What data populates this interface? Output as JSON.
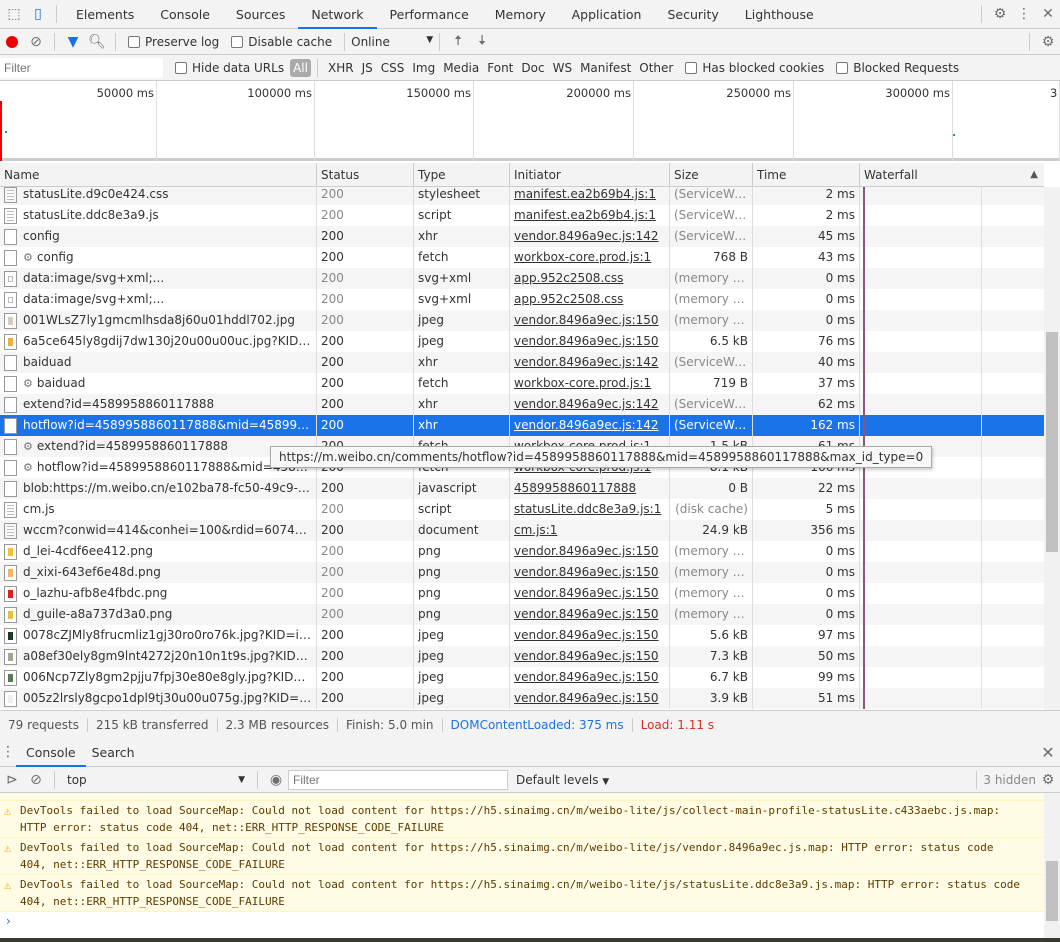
{
  "tabs": [
    "Elements",
    "Console",
    "Sources",
    "Network",
    "Performance",
    "Memory",
    "Application",
    "Security",
    "Lighthouse"
  ],
  "active_tab": "Network",
  "toolbar": {
    "preserve_log": "Preserve log",
    "disable_cache": "Disable cache",
    "throttle": "Online"
  },
  "filterbar": {
    "placeholder": "Filter",
    "hide_data_urls": "Hide data URLs",
    "types": [
      "All",
      "XHR",
      "JS",
      "CSS",
      "Img",
      "Media",
      "Font",
      "Doc",
      "WS",
      "Manifest",
      "Other"
    ],
    "has_blocked_cookies": "Has blocked cookies",
    "blocked_requests": "Blocked Requests"
  },
  "overview": {
    "ticks": [
      "50000 ms",
      "100000 ms",
      "150000 ms",
      "200000 ms",
      "250000 ms",
      "300000 ms",
      "3"
    ]
  },
  "columns": [
    "Name",
    "Status",
    "Type",
    "Initiator",
    "Size",
    "Time",
    "Waterfall"
  ],
  "rows": [
    {
      "icon": "doc",
      "name": "statusLite.d9c0e424.css",
      "status": "200",
      "type": "stylesheet",
      "initiator": "manifest.ea2b69b4.js:1",
      "size": "(ServiceWor...",
      "time": "2 ms",
      "cached": true
    },
    {
      "icon": "doc",
      "name": "statusLite.ddc8e3a9.js",
      "status": "200",
      "type": "script",
      "initiator": "manifest.ea2b69b4.js:1",
      "size": "(ServiceWor...",
      "time": "2 ms",
      "cached": true
    },
    {
      "icon": "blank",
      "name": "config",
      "status": "200",
      "type": "xhr",
      "initiator": "vendor.8496a9ec.js:142",
      "size": "(ServiceWor...",
      "time": "45 ms"
    },
    {
      "icon": "blank",
      "sw": true,
      "name": "config",
      "status": "200",
      "type": "fetch",
      "initiator": "workbox-core.prod.js:1",
      "size": "768 B",
      "time": "43 ms"
    },
    {
      "icon": "svg",
      "name": "data:image/svg+xml;...",
      "status": "200",
      "type": "svg+xml",
      "initiator": "app.952c2508.css",
      "size": "(memory ca...",
      "time": "0 ms",
      "cached": true
    },
    {
      "icon": "svg",
      "name": "data:image/svg+xml;...",
      "status": "200",
      "type": "svg+xml",
      "initiator": "app.952c2508.css",
      "size": "(memory ca...",
      "time": "0 ms",
      "cached": true
    },
    {
      "icon": "img",
      "color": "#d8c8c0",
      "name": "001WLsZ7ly1gmcmlhsda8j60u01hddl702.jpg",
      "status": "200",
      "type": "jpeg",
      "initiator": "vendor.8496a9ec.js:150",
      "size": "(memory ca...",
      "time": "0 ms",
      "cached": true
    },
    {
      "icon": "img",
      "color": "#f0b040",
      "name": "6a5ce645ly8gdij7dw130j20u00u00uc.jpg?KID=imgbe...",
      "status": "200",
      "type": "jpeg",
      "initiator": "vendor.8496a9ec.js:150",
      "size": "6.5 kB",
      "time": "76 ms"
    },
    {
      "icon": "blank",
      "name": "baiduad",
      "status": "200",
      "type": "xhr",
      "initiator": "vendor.8496a9ec.js:142",
      "size": "(ServiceWor...",
      "time": "40 ms"
    },
    {
      "icon": "blank",
      "sw": true,
      "name": "baiduad",
      "status": "200",
      "type": "fetch",
      "initiator": "workbox-core.prod.js:1",
      "size": "719 B",
      "time": "37 ms"
    },
    {
      "icon": "blank",
      "name": "extend?id=4589958860117888",
      "status": "200",
      "type": "xhr",
      "initiator": "vendor.8496a9ec.js:142",
      "size": "(ServiceWor...",
      "time": "62 ms"
    },
    {
      "icon": "blank",
      "name": "hotflow?id=4589958860117888&mid=458995886011...",
      "status": "200",
      "type": "xhr",
      "initiator": "vendor.8496a9ec.js:142",
      "size": "(ServiceWor...",
      "time": "162 ms",
      "selected": true
    },
    {
      "icon": "blank",
      "sw": true,
      "name": "extend?id=4589958860117888",
      "status": "200",
      "type": "fetch",
      "initiator": "workbox-core.prod.js:1",
      "size": "1.5 kB",
      "time": "61 ms"
    },
    {
      "icon": "blank",
      "sw": true,
      "name": "hotflow?id=4589958860117888&mid=458995886011...",
      "status": "200",
      "type": "fetch",
      "initiator": "workbox-core.prod.js:1",
      "size": "8.1 kB",
      "time": "166 ms"
    },
    {
      "icon": "blank",
      "name": "blob:https://m.weibo.cn/e102ba78-fc50-49c9-b0a7-a...",
      "status": "200",
      "type": "javascript",
      "initiator": "4589958860117888",
      "size": "0 B",
      "time": "22 ms"
    },
    {
      "icon": "doc",
      "name": "cm.js",
      "status": "200",
      "type": "script",
      "initiator": "statusLite.ddc8e3a9.js:1",
      "size": "(disk cache)",
      "time": "5 ms",
      "cached": true
    },
    {
      "icon": "doc",
      "name": "wccm?conwid=414&conhei=100&rdid=6074883&dc...",
      "status": "200",
      "type": "document",
      "initiator": "cm.js:1",
      "size": "24.9 kB",
      "time": "356 ms"
    },
    {
      "icon": "img",
      "color": "#f4c430",
      "name": "d_lei-4cdf6ee412.png",
      "status": "200",
      "type": "png",
      "initiator": "vendor.8496a9ec.js:150",
      "size": "(memory ca...",
      "time": "0 ms",
      "cached": true
    },
    {
      "icon": "img",
      "color": "#f7b267",
      "name": "d_xixi-643ef6e48d.png",
      "status": "200",
      "type": "png",
      "initiator": "vendor.8496a9ec.js:150",
      "size": "(memory ca...",
      "time": "0 ms",
      "cached": true
    },
    {
      "icon": "img",
      "color": "#e02020",
      "name": "o_lazhu-afb8e4fbdc.png",
      "status": "200",
      "type": "png",
      "initiator": "vendor.8496a9ec.js:150",
      "size": "(memory ca...",
      "time": "0 ms",
      "cached": true
    },
    {
      "icon": "img",
      "color": "#e8c040",
      "name": "d_guile-a8a737d3a0.png",
      "status": "200",
      "type": "png",
      "initiator": "vendor.8496a9ec.js:150",
      "size": "(memory ca...",
      "time": "0 ms",
      "cached": true
    },
    {
      "icon": "img",
      "color": "#1d3a2a",
      "name": "0078cZJMly8frucmliz1gj30ro0ro76k.jpg?KID=imgbed,...",
      "status": "200",
      "type": "jpeg",
      "initiator": "vendor.8496a9ec.js:150",
      "size": "5.6 kB",
      "time": "97 ms"
    },
    {
      "icon": "img",
      "color": "#a0a890",
      "name": "a08ef30ely8gm9lnt4272j20n10n1t9s.jpg?KID=imgbed...",
      "status": "200",
      "type": "jpeg",
      "initiator": "vendor.8496a9ec.js:150",
      "size": "7.3 kB",
      "time": "50 ms"
    },
    {
      "icon": "img",
      "color": "#5a7a50",
      "name": "006Ncp7Zly8gm2pjju7fpj30e80e8gly.jpg?KID=imgbe...",
      "status": "200",
      "type": "jpeg",
      "initiator": "vendor.8496a9ec.js:150",
      "size": "6.7 kB",
      "time": "99 ms"
    },
    {
      "icon": "img",
      "color": "#eeeeee",
      "name": "005z2lrsly8gcpo1dpl9tj30u00u075g.jpg?KID=imgbed,...",
      "status": "200",
      "type": "jpeg",
      "initiator": "vendor.8496a9ec.js:150",
      "size": "3.9 kB",
      "time": "51 ms"
    }
  ],
  "tooltip": "https://m.weibo.cn/comments/hotflow?id=4589958860117888&mid=4589958860117888&max_id_type=0",
  "status": {
    "requests": "79 requests",
    "transferred": "215 kB transferred",
    "resources": "2.3 MB resources",
    "finish": "Finish: 5.0 min",
    "dcl": "DOMContentLoaded: 375 ms",
    "load": "Load: 1.11 s"
  },
  "colors": {
    "accent": "#1a73e8",
    "dcl": "#1a73e8",
    "load": "#d93025",
    "warning_bg": "#fffbe5",
    "record": "#e00"
  },
  "drawer": {
    "tabs": [
      "Console",
      "Search"
    ],
    "context": "top",
    "filter_placeholder": "Filter",
    "levels": "Default levels",
    "hidden": "3 hidden"
  },
  "console": [
    {
      "pre": "DevTools failed to load SourceMap: Could not load content for ",
      "url": "https://h5.sinaimg.cn/m/weibo-lite/js/collect-main-profile-statusLite.c433aebc.js.map",
      "post": ": HTTP error: status code 404, net::ERR_HTTP_RESPONSE_CODE_FAILURE"
    },
    {
      "pre": "DevTools failed to load SourceMap: Could not load content for ",
      "url": "https://h5.sinaimg.cn/m/weibo-lite/js/vendor.8496a9ec.js.map",
      "post": ": HTTP error: status code 404, net::ERR_HTTP_RESPONSE_CODE_FAILURE"
    },
    {
      "pre": "DevTools failed to load SourceMap: Could not load content for ",
      "url": "https://h5.sinaimg.cn/m/weibo-lite/js/statusLite.ddc8e3a9.js.map",
      "post": ": HTTP error: status code 404, net::ERR_HTTP_RESPONSE_CODE_FAILURE"
    }
  ]
}
